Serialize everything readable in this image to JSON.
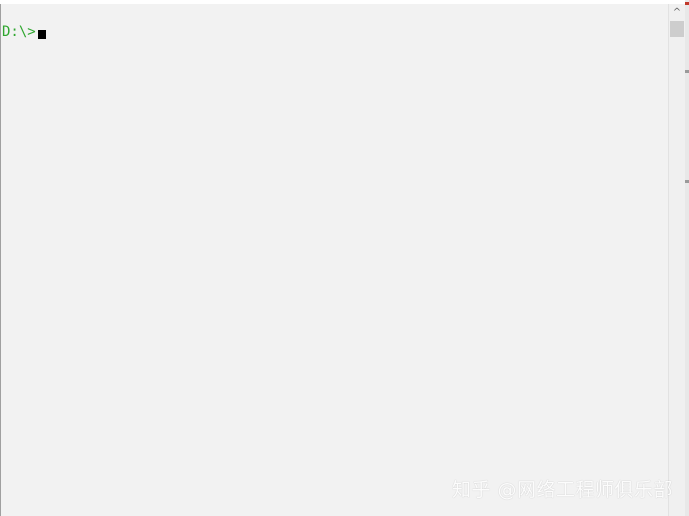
{
  "terminal": {
    "prompt": "D:\\>"
  },
  "scrollbar": {
    "up_arrow": "^"
  },
  "watermark": {
    "text": "知乎 @网络工程师俱乐部"
  },
  "colors": {
    "prompt": "#2fa62f",
    "background": "#f2f2f2",
    "cursor": "#000000"
  }
}
